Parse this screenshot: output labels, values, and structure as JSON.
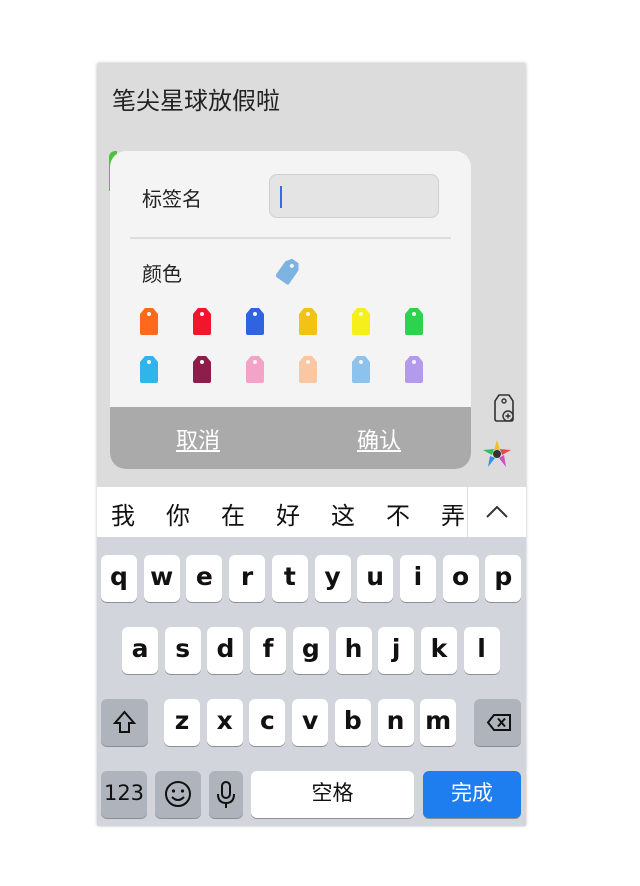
{
  "note": {
    "title": "笔尖星球放假啦"
  },
  "dialog": {
    "name_label": "标签名",
    "name_value": "",
    "color_label": "颜色",
    "selected_color": "#7db3e2",
    "colors_row1": [
      "#ff6a1a",
      "#f0162b",
      "#2f63df",
      "#f2c313",
      "#f7ef1b",
      "#2dd34c"
    ],
    "colors_row2": [
      "#2fb5ec",
      "#8d1d4b",
      "#f4a3c8",
      "#f9c7a1",
      "#8dc2ec",
      "#b49aed"
    ],
    "cancel_label": "取消",
    "confirm_label": "确认"
  },
  "candidates": [
    "我",
    "你",
    "在",
    "好",
    "这",
    "不",
    "弄"
  ],
  "keyboard": {
    "row1": [
      "q",
      "w",
      "e",
      "r",
      "t",
      "y",
      "u",
      "i",
      "o",
      "p"
    ],
    "row2": [
      "a",
      "s",
      "d",
      "f",
      "g",
      "h",
      "j",
      "k",
      "l"
    ],
    "row3": [
      "z",
      "x",
      "c",
      "v",
      "b",
      "n",
      "m"
    ],
    "numbers_label": "123",
    "space_label": "空格",
    "done_label": "完成"
  }
}
